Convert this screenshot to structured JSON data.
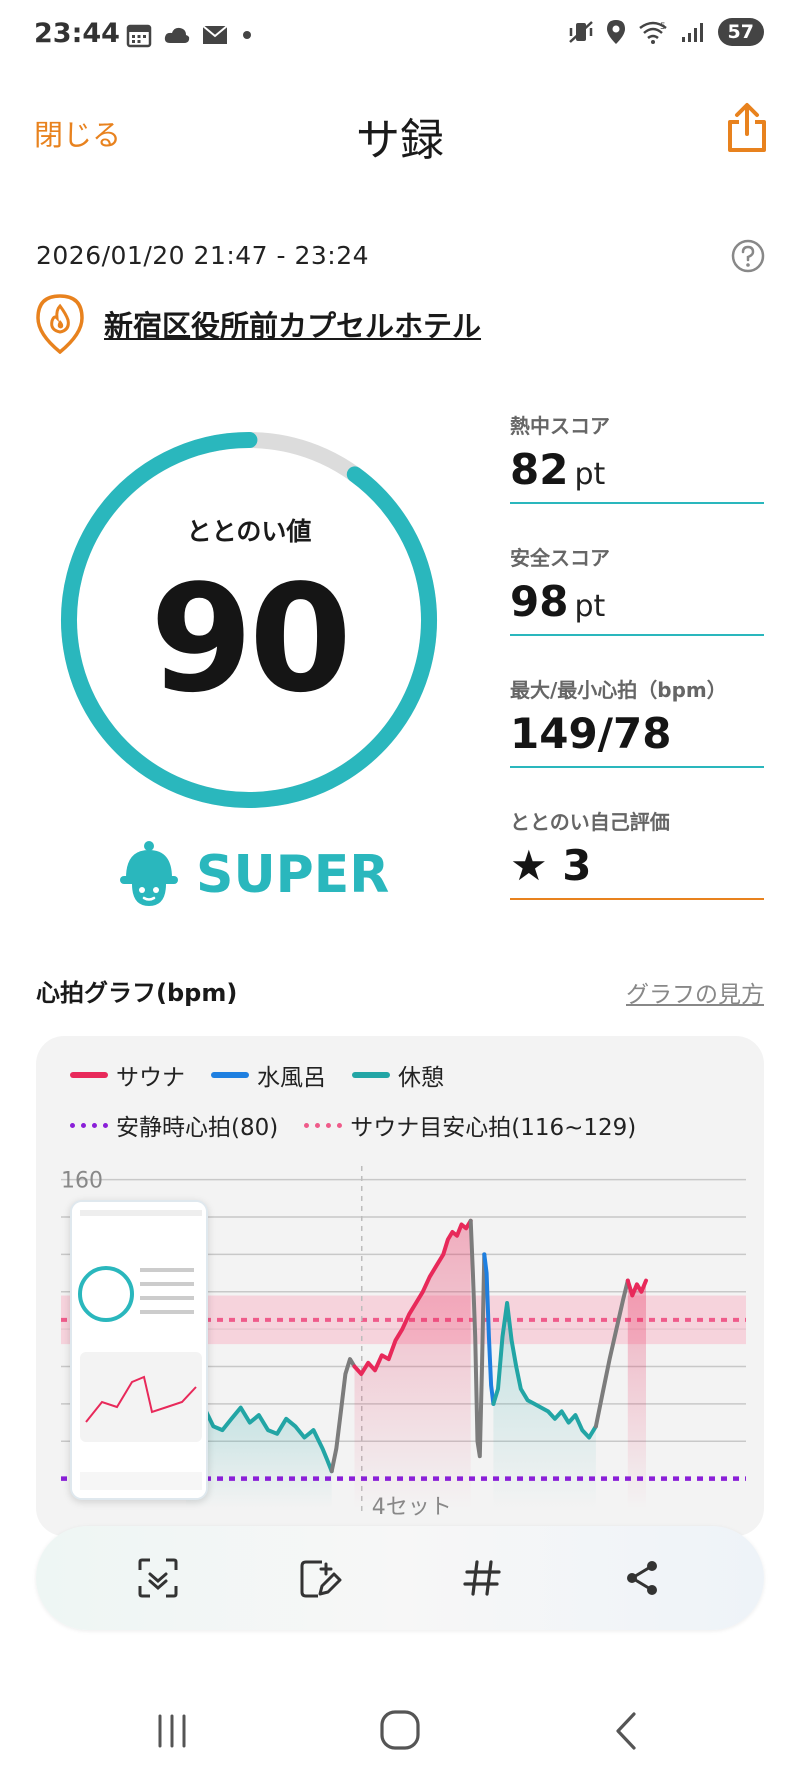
{
  "status": {
    "time": "23:44",
    "battery": "57",
    "network": "5"
  },
  "header": {
    "close": "閉じる",
    "title": "サ録"
  },
  "session": {
    "datetime": "2026/01/20 21:47 - 23:24",
    "facility": "新宿区役所前カプセルホテル"
  },
  "totonoi": {
    "label": "ととのい値",
    "value": "90",
    "max": 100,
    "rank": "SUPER"
  },
  "metrics": [
    {
      "label": "熱中スコア",
      "value": "82",
      "unit": "pt"
    },
    {
      "label": "安全スコア",
      "value": "98",
      "unit": "pt"
    },
    {
      "label": "最大/最小心拍（bpm）",
      "value": "149/78",
      "unit": ""
    },
    {
      "label": "ととのい自己評価",
      "value": "★ 3",
      "unit": ""
    }
  ],
  "graph": {
    "title": "心拍グラフ(bpm)",
    "help_link": "グラフの見方",
    "legend": {
      "sauna": "サウナ",
      "water": "水風呂",
      "rest": "休憩",
      "resting": "安静時心拍(80)",
      "target": "サウナ目安心拍(116~129)"
    },
    "colors": {
      "sauna": "#e8295a",
      "water": "#1e7fe0",
      "rest": "#22a5a5",
      "resting": "#8a1fd8",
      "target": "#ef5b8a",
      "neutral": "#7c7c7c"
    }
  },
  "chart_data": {
    "type": "line",
    "title": "心拍グラフ(bpm)",
    "y_tick": "160",
    "ylim": [
      70,
      165
    ],
    "set_label": "4セット",
    "resting_hr": 80,
    "target_band": [
      116,
      129
    ],
    "segments": [
      {
        "phase": "rest",
        "points": [
          [
            0,
            102
          ],
          [
            4,
            96
          ],
          [
            8,
            99
          ],
          [
            12,
            94
          ],
          [
            16,
            93
          ],
          [
            20,
            96
          ],
          [
            24,
            99
          ],
          [
            28,
            95
          ],
          [
            32,
            97
          ],
          [
            36,
            93
          ],
          [
            40,
            92
          ],
          [
            44,
            96
          ],
          [
            48,
            94
          ],
          [
            52,
            91
          ],
          [
            56,
            93
          ],
          [
            60,
            88
          ],
          [
            62,
            85
          ],
          [
            64,
            82
          ]
        ]
      },
      {
        "phase": "neutral",
        "points": [
          [
            64,
            82
          ],
          [
            66,
            88
          ],
          [
            68,
            98
          ],
          [
            70,
            108
          ],
          [
            72,
            112
          ],
          [
            74,
            110
          ]
        ]
      },
      {
        "phase": "sauna",
        "points": [
          [
            74,
            110
          ],
          [
            77,
            108
          ],
          [
            80,
            111
          ],
          [
            83,
            109
          ],
          [
            86,
            113
          ],
          [
            89,
            112
          ],
          [
            92,
            117
          ],
          [
            95,
            120
          ],
          [
            98,
            124
          ],
          [
            101,
            127
          ],
          [
            104,
            130
          ],
          [
            107,
            134
          ],
          [
            110,
            137
          ],
          [
            113,
            140
          ],
          [
            115,
            144
          ],
          [
            117,
            146
          ],
          [
            119,
            145
          ],
          [
            121,
            148
          ],
          [
            123,
            147
          ],
          [
            125,
            149
          ]
        ]
      },
      {
        "phase": "neutral",
        "points": [
          [
            125,
            149
          ],
          [
            126,
            135
          ],
          [
            127,
            118
          ],
          [
            128,
            90
          ],
          [
            129,
            86
          ],
          [
            130,
            110
          ],
          [
            131,
            140
          ]
        ]
      },
      {
        "phase": "water",
        "points": [
          [
            131,
            140
          ],
          [
            132,
            135
          ],
          [
            133,
            118
          ],
          [
            134,
            105
          ],
          [
            135,
            100
          ]
        ]
      },
      {
        "phase": "rest",
        "points": [
          [
            135,
            100
          ],
          [
            137,
            104
          ],
          [
            139,
            118
          ],
          [
            141,
            127
          ],
          [
            143,
            117
          ],
          [
            145,
            110
          ],
          [
            147,
            104
          ],
          [
            150,
            101
          ],
          [
            153,
            100
          ],
          [
            156,
            99
          ],
          [
            159,
            98
          ],
          [
            162,
            96
          ],
          [
            165,
            98
          ],
          [
            168,
            95
          ],
          [
            171,
            97
          ],
          [
            174,
            93
          ],
          [
            177,
            91
          ],
          [
            180,
            94
          ]
        ]
      },
      {
        "phase": "neutral",
        "points": [
          [
            180,
            94
          ],
          [
            183,
            103
          ],
          [
            186,
            112
          ],
          [
            189,
            120
          ],
          [
            192,
            128
          ],
          [
            194,
            133
          ]
        ]
      },
      {
        "phase": "sauna",
        "points": [
          [
            194,
            133
          ],
          [
            196,
            129
          ],
          [
            198,
            132
          ],
          [
            200,
            130
          ],
          [
            202,
            133
          ]
        ]
      }
    ]
  },
  "toolbar": [
    "scan-icon",
    "edit-icon",
    "hashtag-icon",
    "share-icon"
  ]
}
